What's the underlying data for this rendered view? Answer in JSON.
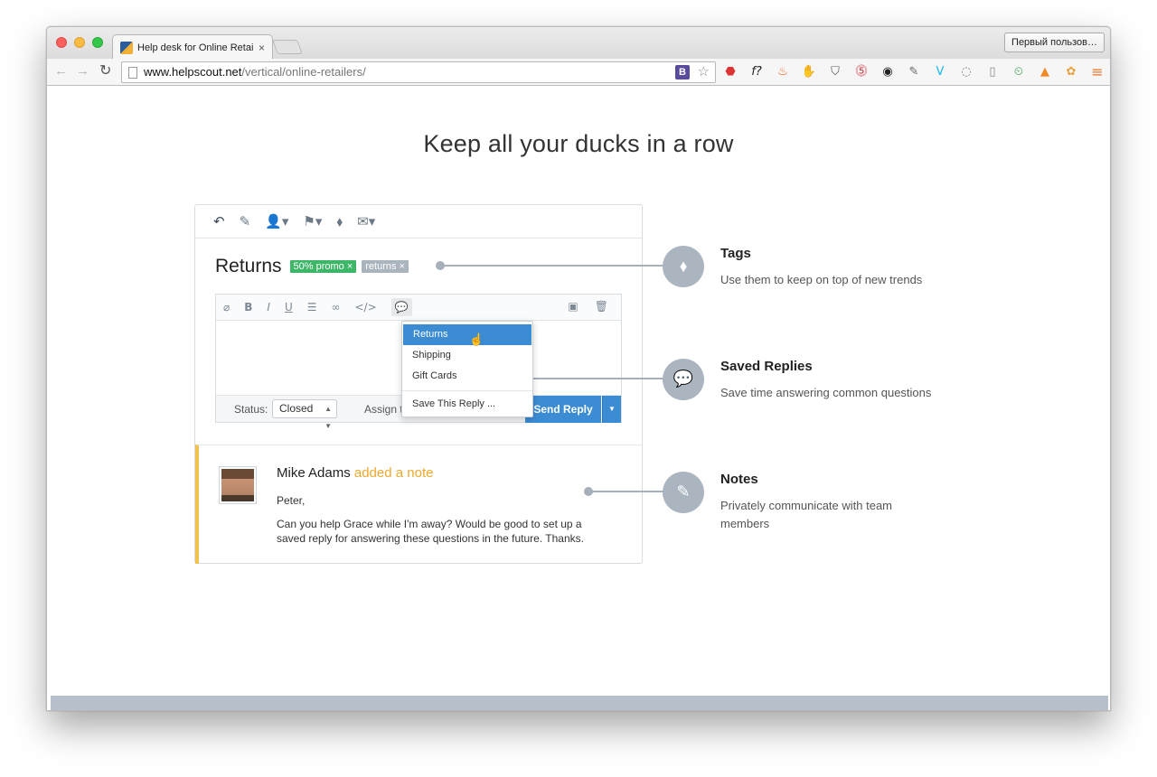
{
  "browser": {
    "tab_title": "Help desk for Online Retail",
    "tab_close": "×",
    "profile": "Первый пользов…",
    "url_host": "www.helpscout.net",
    "url_path": "/vertical/online-retailers/",
    "omnibox_ext": "B",
    "nav": {
      "back": "←",
      "forward": "→",
      "reload": "↻"
    },
    "extensions": [
      "stop-icon",
      "fx-icon",
      "fire-icon",
      "evernote-icon",
      "pocket-icon",
      "pinterest-icon",
      "camera-icon",
      "dropper-icon",
      "vimeo-icon",
      "circle-icon",
      "reader-icon",
      "timer-icon",
      "chart-icon",
      "paw-icon",
      "menu-icon"
    ]
  },
  "page": {
    "headline": "Keep all your ducks in a row"
  },
  "app": {
    "subject": "Returns",
    "tags": [
      {
        "label": "50% promo ×",
        "color": "#3eb668"
      },
      {
        "label": "returns ×",
        "color": "#aab4bd"
      }
    ],
    "status_label": "Status:",
    "status_value": "Closed",
    "assign_label": "Assign to",
    "send_label": "Send Reply",
    "saved_replies": [
      "Returns",
      "Shipping",
      "Gift Cards"
    ],
    "save_reply_label": "Save This Reply ...",
    "note": {
      "author": "Mike Adams",
      "action": "added a note",
      "greeting": "Peter,",
      "body": "Can you help Grace while I'm away? Would be good to set up a saved reply for answering these questions in the future. Thanks."
    }
  },
  "features": [
    {
      "title": "Tags",
      "desc": "Use them to keep on top of new trends",
      "icon": "tag-icon"
    },
    {
      "title": "Saved Replies",
      "desc": "Save time answering common questions",
      "icon": "chat-bubble-icon"
    },
    {
      "title": "Notes",
      "desc": "Privately communicate with team members",
      "icon": "pencil-plus-icon"
    }
  ],
  "colors": {
    "accent_blue": "#3c8cd4",
    "tag_green": "#3eb668",
    "note_yellow": "#f2c14f",
    "connector_grey": "#a6b0bb"
  }
}
